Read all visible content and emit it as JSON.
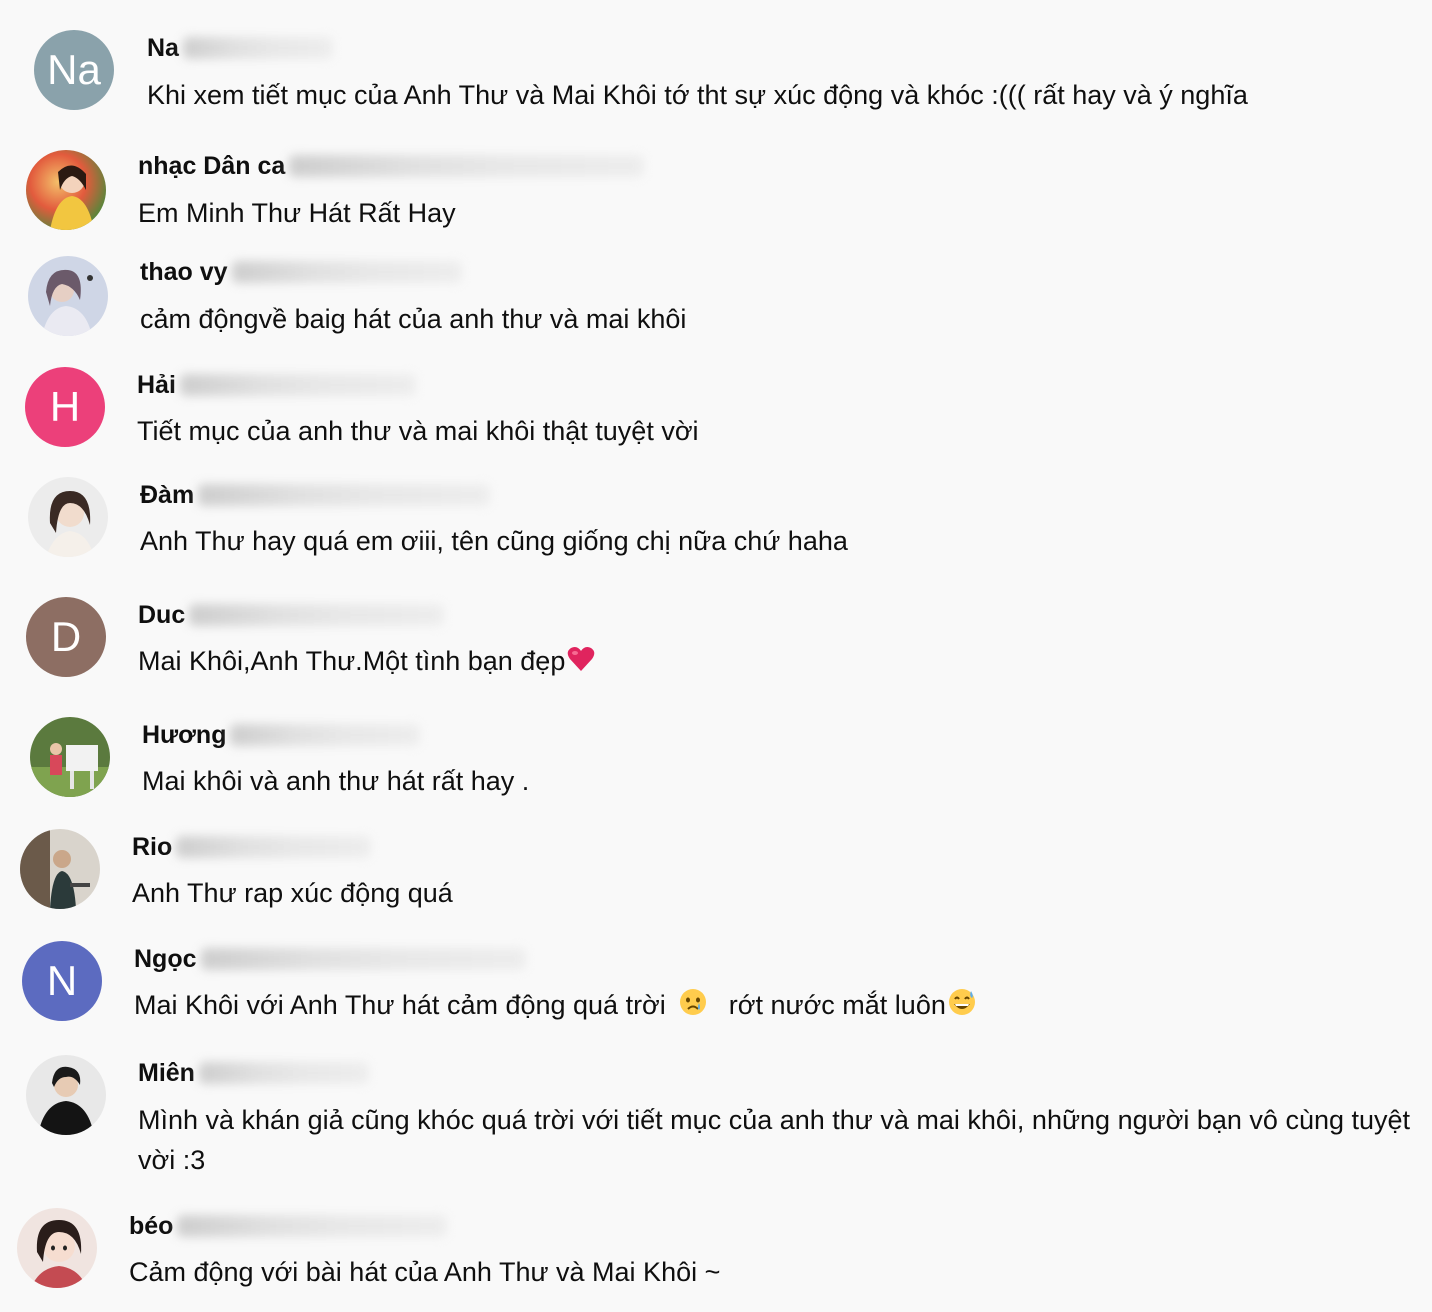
{
  "comments": [
    {
      "author": "Na",
      "avatar": {
        "type": "letter",
        "letter": "Na",
        "color": "#8aa2ab"
      },
      "text": "Khi xem tiết mục của Anh Thư và Mai Khôi tớ tht sự xúc động và khóc :((( rất hay và ý nghĩa"
    },
    {
      "author": "nhạc Dân ca",
      "avatar": {
        "type": "photo",
        "icon": "profile-photo"
      },
      "text": "Em Minh Thư Hát Rất Hay"
    },
    {
      "author": "thao vy",
      "avatar": {
        "type": "photo",
        "icon": "profile-photo"
      },
      "text": "cảm độngvề baig hát của anh thư và mai khôi"
    },
    {
      "author": "Hải",
      "avatar": {
        "type": "letter",
        "letter": "H",
        "color": "#ec407a"
      },
      "text": "Tiết mục của anh thư và mai khôi thật tuyệt vời"
    },
    {
      "author": "Đàm",
      "avatar": {
        "type": "photo",
        "icon": "profile-photo"
      },
      "text": "Anh Thư hay quá em ơiii, tên cũng giống chị nữa chứ haha"
    },
    {
      "author": "Duc",
      "avatar": {
        "type": "letter",
        "letter": "D",
        "color": "#8d6e63"
      },
      "text": "Mai Khôi,Anh Thư.Một tình bạn đẹp",
      "emoji": "red-heart-emoji"
    },
    {
      "author": "Hương",
      "avatar": {
        "type": "photo",
        "icon": "profile-photo"
      },
      "text": "Mai khôi và anh thư hát rất hay ."
    },
    {
      "author": "Rio",
      "avatar": {
        "type": "photo",
        "icon": "profile-photo"
      },
      "text": "Anh Thư rap xúc động quá"
    },
    {
      "author": "Ngọc",
      "avatar": {
        "type": "letter",
        "letter": "N",
        "color": "#5c6bc0"
      },
      "text_part1": "Mai Khôi với Anh Thư hát cảm động quá trời",
      "emoji1": "crying-face-emoji",
      "text_part2": "rớt nước mắt luôn",
      "emoji2": "grinning-sweat-emoji"
    },
    {
      "author": "Miên",
      "avatar": {
        "type": "photo",
        "icon": "profile-photo"
      },
      "text": "Mình và khán giả cũng khóc quá trời với tiết mục của anh thư và mai khôi, những người bạn vô cùng tuyệt",
      "text_line2": "vời :3"
    },
    {
      "author": "béo",
      "avatar": {
        "type": "photo",
        "icon": "profile-photo"
      },
      "text": "Cảm động với bài hát của Anh Thư và Mai Khôi ~"
    }
  ],
  "colors": {
    "background": "#f9f9f9",
    "text": "#0f0f0f",
    "heart": "#e0245e"
  }
}
